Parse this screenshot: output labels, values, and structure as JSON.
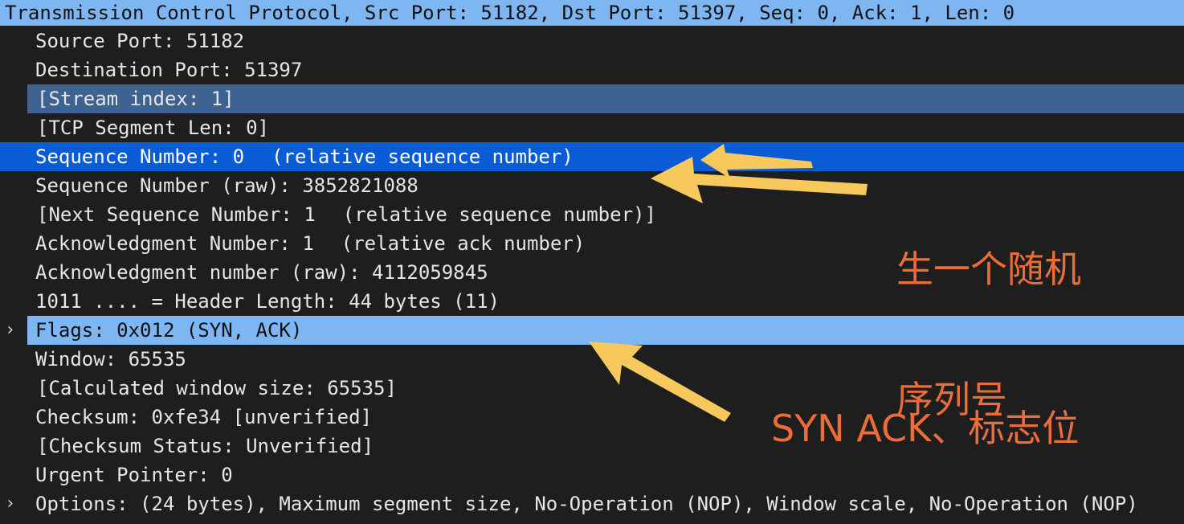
{
  "header": {
    "text": "Transmission Control Protocol, Src Port: 51182, Dst Port: 51397, Seq: 0, Ack: 1, Len: 0"
  },
  "fields": {
    "source_port": "Source Port: 51182",
    "destination_port": "Destination Port: 51397",
    "stream_index": "[Stream index: 1]",
    "segment_len": "[TCP Segment Len: 0]",
    "seq_number_main": "Sequence Number: 0",
    "seq_number_note": "(relative sequence number)",
    "seq_number_raw": "Sequence Number (raw): 3852821088",
    "next_seq_main": "[Next Sequence Number: 1",
    "next_seq_note": "(relative sequence number)]",
    "ack_number_main": "Acknowledgment Number: 1",
    "ack_number_note": "(relative ack number)",
    "ack_number_raw": "Acknowledgment number (raw): 4112059845",
    "header_length": "1011 .... = Header Length: 44 bytes (11)",
    "flags": "Flags: 0x012 (SYN, ACK)",
    "window": "Window: 65535",
    "calc_window": "[Calculated window size: 65535]",
    "checksum": "Checksum: 0xfe34 [unverified]",
    "checksum_status": "[Checksum Status: Unverified]",
    "urgent_pointer": "Urgent Pointer: 0",
    "options": "Options: (24 bytes), Maximum segment size, No-Operation (NOP), Window scale, No-Operation (NOP)"
  },
  "annotations": {
    "random_seq_line1": "生一个随机",
    "random_seq_line2": "序列号",
    "syn_ack_flags": "SYN ACK、标志位"
  },
  "icons": {
    "expand": "chevron-right-icon",
    "arrow": "arrow-left-icon"
  },
  "colors": {
    "background": "#1e1e1e",
    "header_bg": "#7eb6f2",
    "selected_bg": "#0a5bd6",
    "stream_bg": "#3f6391",
    "flags_bg": "#7eb6f2",
    "annotation": "#ec6c3a",
    "arrow": "#f7c95c"
  }
}
